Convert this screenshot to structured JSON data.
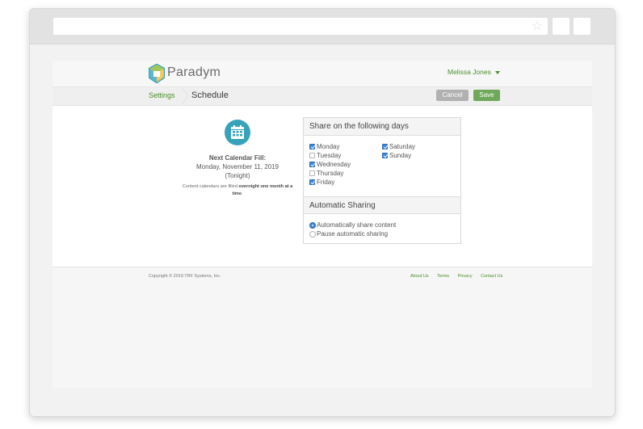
{
  "header": {
    "brand": "Paradym",
    "user_name": "Melissa Jones"
  },
  "breadcrumb": {
    "parent": "Settings",
    "current": "Schedule"
  },
  "actions": {
    "cancel_label": "Cancel",
    "save_label": "Save"
  },
  "next_fill": {
    "title": "Next Calendar Fill:",
    "date": "Monday, November 11, 2019",
    "when": "(Tonight)",
    "note_prefix": "Content calendars are filled ",
    "note_bold": "overnight one month at a time",
    "note_suffix": "."
  },
  "share_days": {
    "heading": "Share on the following days",
    "days": [
      {
        "label": "Monday",
        "checked": true
      },
      {
        "label": "Tuesday",
        "checked": false
      },
      {
        "label": "Wednesday",
        "checked": true
      },
      {
        "label": "Thursday",
        "checked": false
      },
      {
        "label": "Friday",
        "checked": true
      },
      {
        "label": "Saturday",
        "checked": true
      },
      {
        "label": "Sunday",
        "checked": true
      }
    ]
  },
  "auto_sharing": {
    "heading": "Automatic Sharing",
    "options": [
      {
        "label": "Automatically share content",
        "selected": true
      },
      {
        "label": "Pause automatic sharing",
        "selected": false
      }
    ]
  },
  "footer": {
    "copyright": "Copyright © 2019 TRF Systems, Inc.",
    "links": [
      "About Us",
      "Terms",
      "Privacy",
      "Contact Us"
    ]
  },
  "colors": {
    "accent_green": "#4a8f2c",
    "save_green": "#6fa85a",
    "calendar_teal": "#37a3bb",
    "checkbox_blue": "#3d86d6"
  },
  "icons": {
    "brand": "paradym-logo-icon",
    "calendar": "calendar-icon",
    "bookmark": "star-icon",
    "user_menu": "caret-down-icon"
  }
}
